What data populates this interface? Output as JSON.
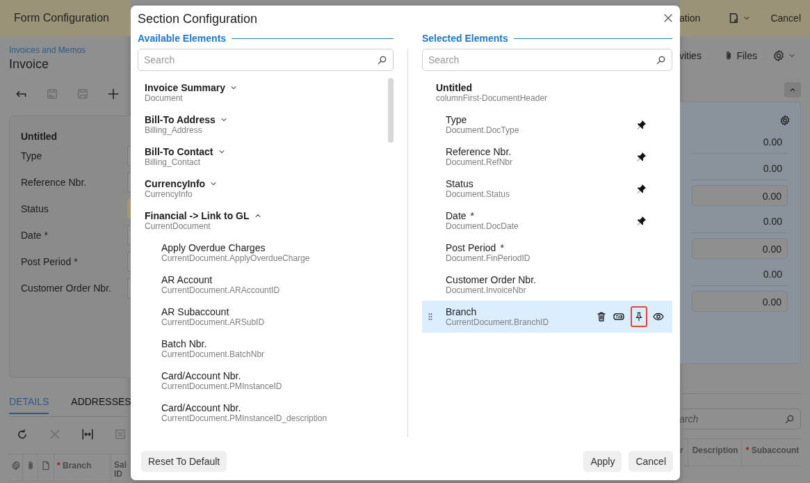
{
  "background": {
    "header": {
      "title": "Form Configuration",
      "cut_title": "ation",
      "cancel": "Cancel"
    },
    "breadcrumb": "Invoices and Memos",
    "page_title": "Invoice",
    "toolbar": [
      {
        "kind": "back",
        "disabled": false
      },
      {
        "kind": "revert",
        "disabled": true
      },
      {
        "kind": "save",
        "disabled": true
      },
      {
        "kind": "add",
        "disabled": false
      }
    ],
    "actions": {
      "cut_label": "vities",
      "files": "Files"
    },
    "card": {
      "title": "Untitled",
      "rows": [
        {
          "label": "Type",
          "kind": "input"
        },
        {
          "label": "Reference Nbr.",
          "kind": "input"
        },
        {
          "label": "Status",
          "kind": "status"
        },
        {
          "label": "Date *",
          "kind": "input"
        },
        {
          "label": "Post Period *",
          "kind": "input"
        },
        {
          "label": "Customer Order Nbr.",
          "kind": "input"
        }
      ]
    },
    "values": [
      {
        "value": "0.00",
        "kind": "plain"
      },
      {
        "value": "0.00",
        "kind": "plain"
      },
      {
        "value": "0.00",
        "kind": "input"
      },
      {
        "value": "0.00",
        "kind": "plain"
      },
      {
        "value": "0.00",
        "kind": "input"
      },
      {
        "value": "0.00",
        "kind": "plain"
      },
      {
        "value": "0.00",
        "kind": "input"
      }
    ],
    "tabs": [
      {
        "label": "DETAILS",
        "selected": true
      },
      {
        "label": "ADDRESSES",
        "selected": false
      }
    ],
    "grid_toolbar": [
      {
        "kind": "refresh",
        "disabled": false
      },
      {
        "kind": "delete",
        "disabled": true
      },
      {
        "kind": "fit",
        "disabled": false
      },
      {
        "kind": "excel",
        "disabled": true
      }
    ],
    "grid_search": {
      "placeholder": "arch"
    },
    "left_columns": [
      {
        "kind": "settings"
      },
      {
        "kind": "files"
      },
      {
        "kind": "notes"
      },
      {
        "kind": "text",
        "label": "Branch",
        "required": true
      },
      {
        "kind": "text",
        "label": "Sal ID",
        "required": false
      }
    ],
    "right_columns": [
      {
        "label": "r",
        "required": false
      },
      {
        "label": "Description",
        "required": false
      },
      {
        "label": "Subaccount",
        "required": true
      }
    ]
  },
  "dialog": {
    "title": "Section Configuration",
    "available": {
      "heading": "Available Elements",
      "search": {
        "placeholder": "Search"
      },
      "items": [
        {
          "label": "Invoice Summary",
          "sub": "Document",
          "expanded": false
        },
        {
          "label": "Bill-To Address",
          "sub": "Billing_Address",
          "expanded": false
        },
        {
          "label": "Bill-To Contact",
          "sub": "Billing_Contact",
          "expanded": false
        },
        {
          "label": "CurrencyInfo",
          "sub": "CurrencyInfo",
          "expanded": false
        },
        {
          "label": "Financial -> Link to GL",
          "sub": "CurrentDocument",
          "expanded": true,
          "children": [
            {
              "label": "Apply Overdue Charges",
              "sub": "CurrentDocument.ApplyOverdueCharge"
            },
            {
              "label": "AR Account",
              "sub": "CurrentDocument.ARAccountID"
            },
            {
              "label": "AR Subaccount",
              "sub": "CurrentDocument.ARSubID"
            },
            {
              "label": "Batch Nbr.",
              "sub": "CurrentDocument.BatchNbr"
            },
            {
              "label": "Card/Account Nbr.",
              "sub": "CurrentDocument.PMInstanceID"
            },
            {
              "label": "Card/Account Nbr.",
              "sub": "CurrentDocument.PMInstanceID_description"
            }
          ]
        }
      ]
    },
    "selected": {
      "heading": "Selected Elements",
      "search": {
        "placeholder": "Search"
      },
      "group": {
        "label": "Untitled",
        "sub": "columnFirst-DocumentHeader"
      },
      "items": [
        {
          "label": "Type",
          "sub": "Document.DocType",
          "pinned": true,
          "selected": false
        },
        {
          "label": "Reference Nbr.",
          "sub": "Document.RefNbr",
          "pinned": true,
          "selected": false
        },
        {
          "label": "Status",
          "sub": "Document.Status",
          "pinned": true,
          "selected": false
        },
        {
          "label": "Date",
          "sub": "Document.DocDate",
          "required_mark": "*",
          "pinned": true,
          "selected": false
        },
        {
          "label": "Post Period",
          "sub": "Document.FinPeriodID",
          "required_mark": "*",
          "pinned": false,
          "selected": false
        },
        {
          "label": "Customer Order Nbr.",
          "sub": "Document.InvoiceNbr",
          "pinned": false,
          "selected": false
        },
        {
          "label": "Branch",
          "sub": "CurrentDocument.BranchID",
          "pinned": false,
          "selected": true,
          "pin_focused": true
        }
      ]
    },
    "buttons": {
      "reset": "Reset To Default",
      "apply": "Apply",
      "cancel": "Cancel"
    }
  }
}
